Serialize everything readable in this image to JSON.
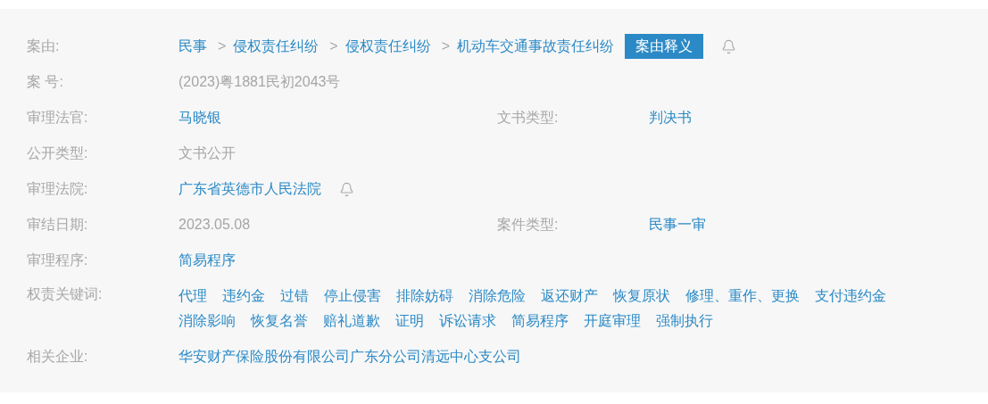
{
  "rows": [
    {
      "kind": "breadcrumb",
      "label": "案由:",
      "crumbs": [
        {
          "label": "民事"
        },
        {
          "separator": ">",
          "label": "侵权责任纠纷"
        },
        {
          "separator": ">",
          "label": "侵权责任纠纷"
        },
        {
          "separator": ">",
          "label": "机动车交通事故责任纠纷"
        }
      ],
      "button": "案由释义",
      "bell": true
    },
    {
      "kind": "field",
      "label": "案 号:",
      "value": "(2023)粤1881民初2043号",
      "link": false
    },
    {
      "kind": "field",
      "label": "审理法官:",
      "value": "马晓银",
      "link": true,
      "right": {
        "label": "文书类型:",
        "value": "判决书",
        "link": true
      }
    },
    {
      "kind": "field",
      "label": "公开类型:",
      "value": "文书公开",
      "link": false
    },
    {
      "kind": "field",
      "label": "审理法院:",
      "value": "广东省英德市人民法院",
      "link": true,
      "bell": true
    },
    {
      "kind": "field",
      "label": "审结日期:",
      "value": "2023.05.08",
      "link": false,
      "right": {
        "label": "案件类型:",
        "value": "民事一审",
        "link": true
      }
    },
    {
      "kind": "field",
      "label": "审理程序:",
      "value": "简易程序",
      "link": true
    },
    {
      "kind": "tags",
      "label": "权责关键词:",
      "tags": [
        "代理",
        "违约金",
        "过错",
        "停止侵害",
        "排除妨碍",
        "消除危险",
        "返还财产",
        "恢复原状",
        "修理、重作、更换",
        "支付违约金",
        "消除影响",
        "恢复名誉",
        "赔礼道歉",
        "证明",
        "诉讼请求",
        "简易程序",
        "开庭审理",
        "强制执行"
      ]
    },
    {
      "kind": "field",
      "label": "相关企业:",
      "value": "华安财产保险股份有限公司广东分公司清远中心支公司",
      "link": true
    }
  ]
}
